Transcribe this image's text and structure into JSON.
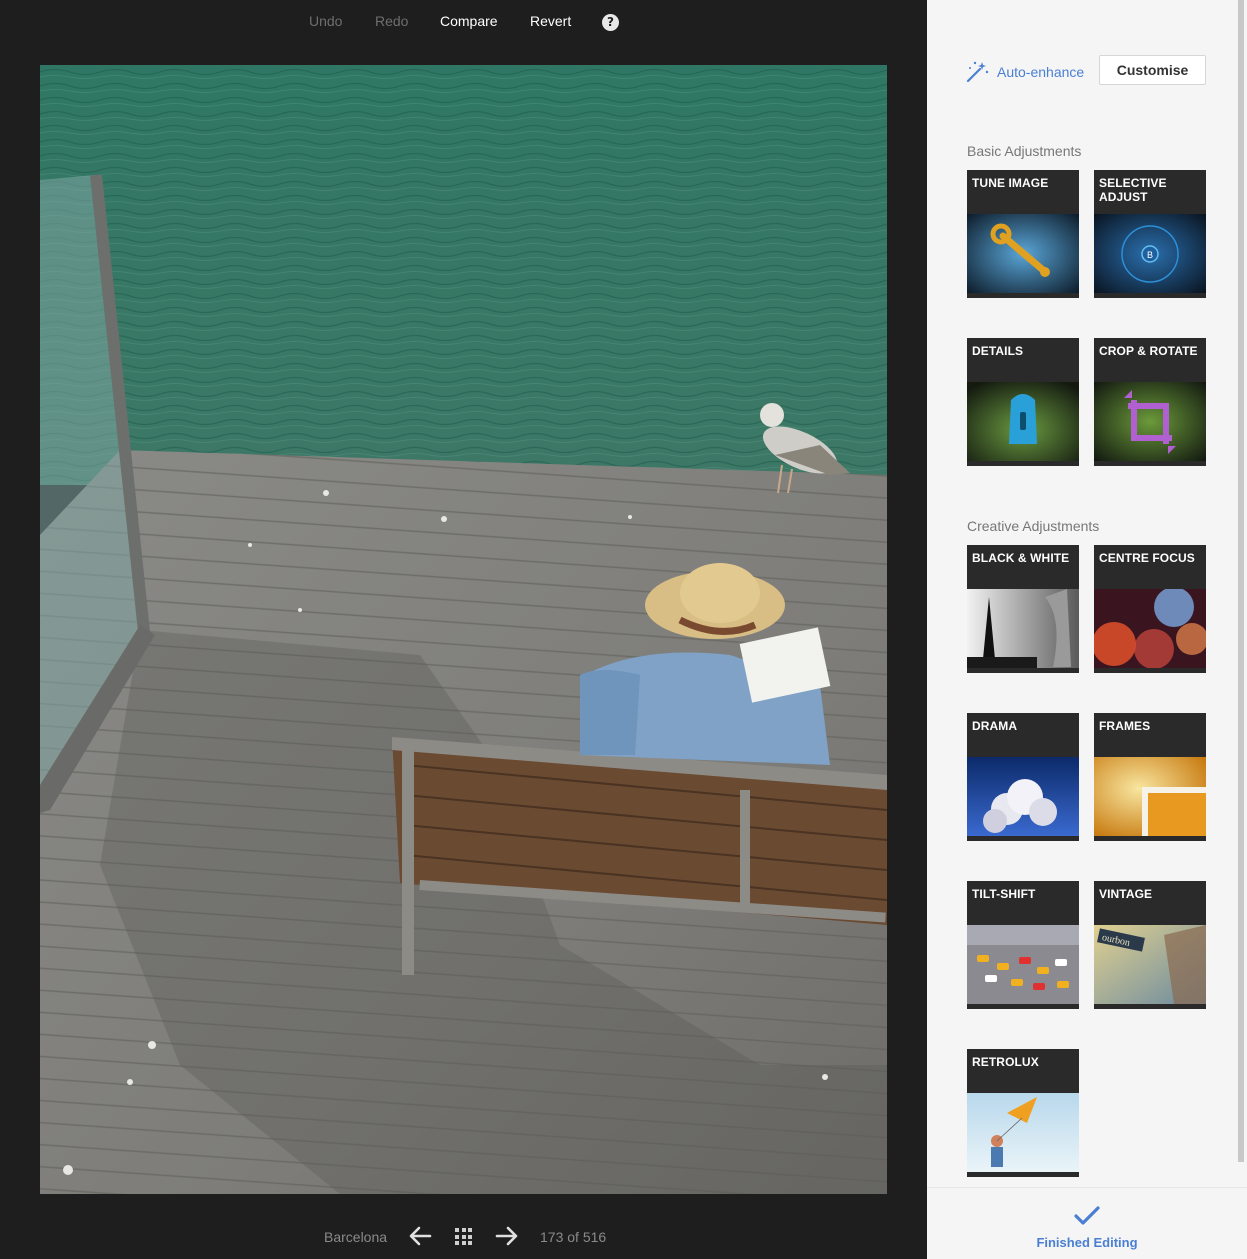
{
  "toolbar": {
    "undo": "Undo",
    "redo": "Redo",
    "compare": "Compare",
    "revert": "Revert",
    "help": "?"
  },
  "nav": {
    "album": "Barcelona",
    "position": "173 of 516",
    "prev_icon": "arrow-left-icon",
    "grid_icon": "grid-icon",
    "next_icon": "arrow-right-icon"
  },
  "panel": {
    "auto_enhance": "Auto-enhance",
    "customise": "Customise",
    "basic_title": "Basic Adjustments",
    "creative_title": "Creative Adjustments",
    "basic": [
      {
        "label": "TUNE IMAGE"
      },
      {
        "label": "SELECTIVE ADJUST"
      },
      {
        "label": "DETAILS"
      },
      {
        "label": "CROP & ROTATE"
      }
    ],
    "creative": [
      {
        "label": "BLACK & WHITE"
      },
      {
        "label": "CENTRE FOCUS"
      },
      {
        "label": "DRAMA"
      },
      {
        "label": "FRAMES"
      },
      {
        "label": "TILT-SHIFT"
      },
      {
        "label": "VINTAGE"
      },
      {
        "label": "RETROLUX"
      }
    ],
    "vintage_sign": "ourbon",
    "selective_badge": "B",
    "finished": "Finished Editing"
  },
  "colors": {
    "accent": "#4a7fd4",
    "viewer_bg": "#1e1e1e",
    "panel_bg": "#f5f5f5"
  }
}
